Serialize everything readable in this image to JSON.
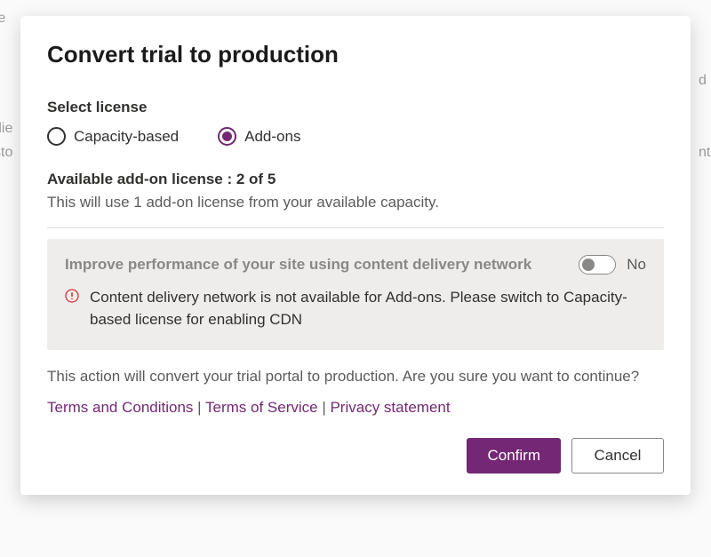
{
  "dialog": {
    "title": "Convert trial to production",
    "select_label": "Select license",
    "radios": {
      "capacity": {
        "label": "Capacity-based",
        "checked": false
      },
      "addons": {
        "label": "Add-ons",
        "checked": true
      }
    },
    "available_line": "Available add-on license : 2 of 5",
    "available_desc": "This will use 1 add-on license from your available capacity.",
    "panel": {
      "heading": "Improve performance of your site using content delivery network",
      "toggle_on": false,
      "toggle_label": "No",
      "message": "Content delivery network is not available for Add-ons. Please switch to Capacity-based license for enabling CDN"
    },
    "confirm_text": "This action will convert your trial portal to production. Are you sure you want to continue?",
    "links": {
      "terms_conditions": "Terms and Conditions",
      "terms_service": "Terms of Service",
      "privacy": "Privacy statement",
      "sep": " | "
    },
    "buttons": {
      "confirm": "Confirm",
      "cancel": "Cancel"
    }
  }
}
